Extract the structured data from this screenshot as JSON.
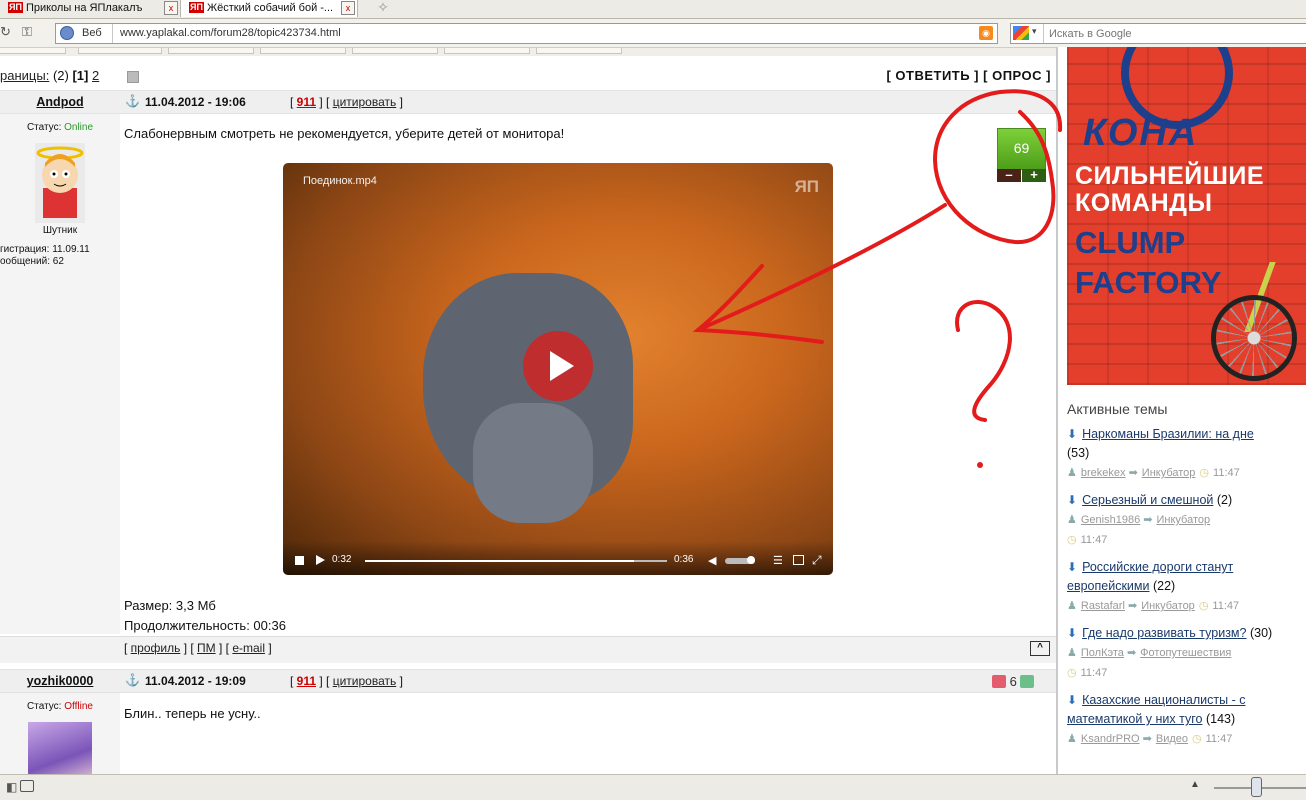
{
  "browser": {
    "tabs": [
      {
        "label": "Приколы на ЯПлакалъ",
        "fav": "ЯП"
      },
      {
        "label": "Жёсткий собачий бой -...",
        "fav": "ЯП"
      }
    ],
    "search_mode": "Веб",
    "url": "www.yaplakal.com/forum28/topic423734.html",
    "search_placeholder": "Искать в Google"
  },
  "forum": {
    "pages_label": "раницы:",
    "pages_count": "(2)",
    "current_page": "[1]",
    "page_2": "2",
    "reply_button": "[ ОТВЕТИТЬ ]",
    "poll_button": "[ ОПРОС ]",
    "posts": [
      {
        "author": "Andpod",
        "date": "11.04.2012 - 19:06",
        "votes": "911",
        "quote": "цитировать",
        "status_label": "Статус:",
        "status": "Online",
        "rank": "Шутник",
        "reg": "гистрация: 11.09.11",
        "msgs": "ообщений: 62",
        "text": "Слабонервным смотреть не рекомендуется, уберите детей от монитора!",
        "rating": "69",
        "rating_minus": "–",
        "rating_plus": "+",
        "video": {
          "title": "Поединок.mp4",
          "watermark": "ЯП",
          "current": "0:32",
          "duration": "0:36",
          "progress": 0.89
        },
        "size_label": "Размер: 3,3 Мб",
        "duration_label": "Продолжительность: 00:36",
        "links": {
          "profile": "профиль",
          "pm": "ПМ",
          "email": "e-mail"
        },
        "top_button": "^"
      },
      {
        "author": "yozhik0000",
        "date": "11.04.2012 - 19:09",
        "votes": "911",
        "quote": "цитировать",
        "status_label": "Статус:",
        "status": "Offline",
        "text": "Блин.. теперь не усну..",
        "rating": "6"
      }
    ]
  },
  "annotations": {
    "color": "#e31b1b",
    "question_mark": "?"
  },
  "sidebar": {
    "ad": {
      "brand": "КОНА",
      "line1": "СИЛЬНЕЙШИЕ",
      "line2": "КОМАНДЫ",
      "line3": "CLUMP",
      "line4": "FACTORY"
    },
    "active_title": "Активные темы",
    "topics": [
      {
        "title": "Наркоманы Бразилии: на дне",
        "count": "(53)",
        "user": "brekekex",
        "forum": "Инкубатор",
        "time": "11:47"
      },
      {
        "title": "Серьезный и смешной",
        "count": "(2)",
        "user": "Genish1986",
        "forum": "Инкубатор",
        "time": "11:47"
      },
      {
        "title": "Российские дороги станут европейскими",
        "count": "(22)",
        "user": "Rastafarl",
        "forum": "Инкубатор",
        "time": "11:47"
      },
      {
        "title": "Где надо развивать туризм?",
        "count": "(30)",
        "user": "ПолКэта",
        "forum": "Фотопутешествия",
        "time": "11:47"
      },
      {
        "title": "Казахские националисты - с математикой у них туго",
        "count": "(143)",
        "user": "KsandrPRO",
        "forum": "Видео",
        "time": "11:47"
      }
    ]
  }
}
